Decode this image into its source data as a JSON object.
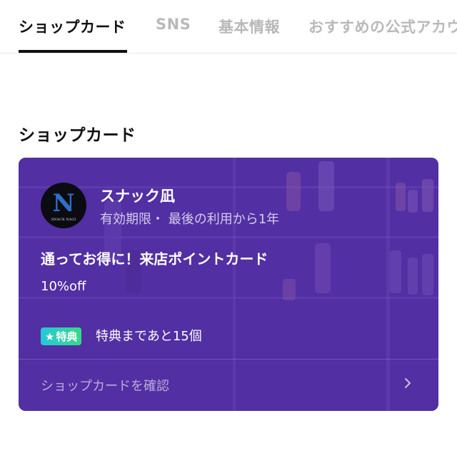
{
  "tabs": [
    {
      "label": "ショップカード"
    },
    {
      "label": "SNS"
    },
    {
      "label": "基本情報"
    },
    {
      "label": "おすすめの公式アカウント"
    }
  ],
  "section_title": "ショップカード",
  "card": {
    "shop_name": "スナック凪",
    "validity": "有効期限・ 最後の利用から1年",
    "title": "通ってお得に！来店ポイントカード",
    "discount": "10%off",
    "badge_label": "特典",
    "remaining": "特典まであと15個",
    "confirm_label": "ショップカードを確認",
    "logo_letter": "N",
    "logo_caption": "SNACK NAGI"
  },
  "colors": {
    "card_purple": "#5a36a6",
    "badge_start": "#25c8d8",
    "badge_end": "#38d886",
    "inactive_tab": "#b9b9b9"
  },
  "icons": [
    "star-icon",
    "chevron-right-icon"
  ]
}
